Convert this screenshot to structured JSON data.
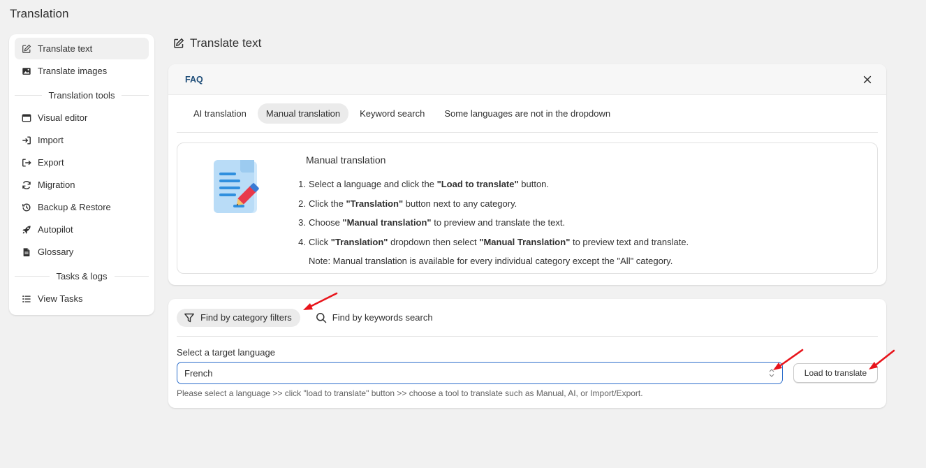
{
  "app": {
    "title": "Translation"
  },
  "sidebar": {
    "items_top": [
      {
        "label": "Translate text",
        "icon": "edit-icon",
        "active": true
      },
      {
        "label": "Translate images",
        "icon": "image-icon",
        "active": false
      }
    ],
    "section_tools": "Translation tools",
    "items_tools": [
      {
        "label": "Visual editor",
        "icon": "browser-window-icon"
      },
      {
        "label": "Import",
        "icon": "import-icon"
      },
      {
        "label": "Export",
        "icon": "export-icon"
      },
      {
        "label": "Migration",
        "icon": "refresh-icon"
      },
      {
        "label": "Backup & Restore",
        "icon": "history-icon"
      },
      {
        "label": "Autopilot",
        "icon": "rocket-icon"
      },
      {
        "label": "Glossary",
        "icon": "document-icon"
      }
    ],
    "section_tasks": "Tasks & logs",
    "items_tasks": [
      {
        "label": "View Tasks",
        "icon": "list-icon"
      }
    ]
  },
  "main": {
    "heading": "Translate text",
    "faq": {
      "label": "FAQ",
      "tabs": [
        {
          "label": "AI translation",
          "active": false
        },
        {
          "label": "Manual translation",
          "active": true
        },
        {
          "label": "Keyword search",
          "active": false
        },
        {
          "label": "Some languages are not in the dropdown",
          "active": false
        }
      ],
      "info_title": "Manual translation",
      "steps": [
        {
          "num": "1.",
          "pre": "Select a language and click the ",
          "bold": "\"Load to translate\"",
          "post": " button.",
          "bold2": "",
          "post2": ""
        },
        {
          "num": "2.",
          "pre": "Click the ",
          "bold": "\"Translation\"",
          "post": " button next to any category.",
          "bold2": "",
          "post2": ""
        },
        {
          "num": "3.",
          "pre": "Choose ",
          "bold": "\"Manual translation\"",
          "post": " to preview and translate the text.",
          "bold2": "",
          "post2": ""
        },
        {
          "num": "4.",
          "pre": "Click ",
          "bold": "\"Translation\"",
          "post": " dropdown then select ",
          "bold2": "\"Manual Translation\"",
          "post2": " to preview text and translate."
        }
      ],
      "note": "Note: Manual translation is available for every individual category except the \"All\" category."
    },
    "filters": {
      "tabs": [
        {
          "label": "Find by category filters",
          "icon": "filter-icon",
          "active": true
        },
        {
          "label": "Find by keywords search",
          "icon": "search-icon",
          "active": false
        }
      ],
      "language_label": "Select a target language",
      "language_value": "French",
      "load_button": "Load to translate",
      "help_text": "Please select a language >> click \"load to translate\" button >> choose a tool to translate such as Manual, AI, or Import/Export."
    }
  },
  "colors": {
    "accent_blue": "#2c6ecb",
    "faq_label": "#1f4e79",
    "annotation_arrow": "#e8141b"
  }
}
